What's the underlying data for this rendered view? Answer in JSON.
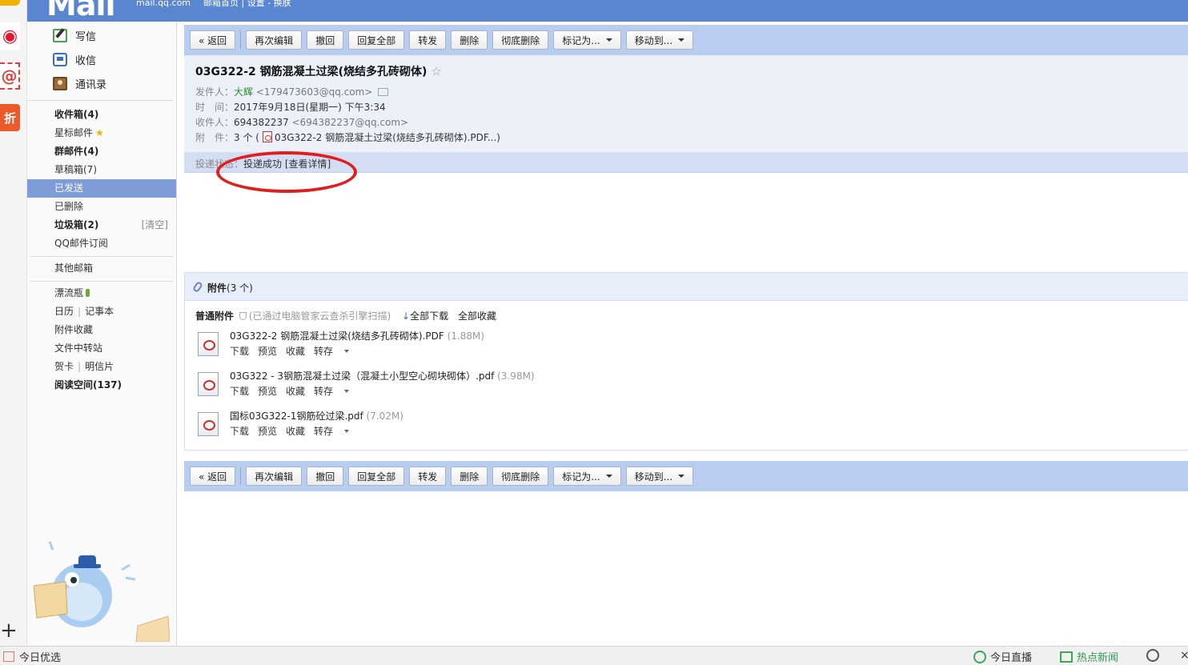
{
  "header": {
    "logo": "Mail",
    "domain": "mail.qq.com",
    "links": "邮箱首页 | 设置 - 换肤"
  },
  "apps": {
    "weibo_icon": "weibo-icon",
    "at_icon": "at-icon",
    "discount_label": "折",
    "add": "+"
  },
  "sidebar": {
    "write": "写信",
    "inbox_tool": "收信",
    "contacts": "通讯录",
    "folders": [
      {
        "label": "收件箱(4)",
        "bold": true
      },
      {
        "label": "星标邮件"
      },
      {
        "label": "群邮件(4)",
        "bold": true
      },
      {
        "label": "草稿箱(7)"
      },
      {
        "label": "已发送",
        "active": true
      },
      {
        "label": "已删除"
      },
      {
        "label": "垃圾箱(2)",
        "bold": true
      },
      {
        "label": "QQ邮件订阅"
      }
    ],
    "clear_trash": "[清空]",
    "other_mailboxes": "其他邮箱",
    "extras": {
      "drift_bottle": "漂流瓶",
      "calendar": "日历",
      "notebook": "记事本",
      "attachment_collection": "附件收藏",
      "file_transfer": "文件中转站",
      "greeting_card": "贺卡",
      "postcard": "明信片",
      "reading_space": "阅读空间(137)",
      "pipe": "|"
    }
  },
  "toolbar": {
    "back": "« 返回",
    "re_edit": "再次编辑",
    "recall": "撤回",
    "reply_all": "回复全部",
    "forward": "转发",
    "delete": "删除",
    "delete_permanently": "彻底删除",
    "mark_as": "标记为...",
    "move_to": "移动到..."
  },
  "mail": {
    "subject": "03G322-2 钢筋混凝土过梁(烧结多孔砖砌体)",
    "star": "☆",
    "from_label": "发件人：",
    "from_name": "大辉",
    "from_addr": "<179473603@qq.com>",
    "time_label": "时　间：",
    "time_value": "2017年9月18日(星期一) 下午3:34",
    "to_label": "收件人：",
    "to_name": "694382237",
    "to_addr": "<694382237@qq.com>",
    "attach_label": "附　件：",
    "attach_count": "3 个 (",
    "attach_first": "03G322-2 钢筋混凝土过梁(烧结多孔砖砌体).PDF...)",
    "status_label": "投递状态：",
    "status_value": "投递成功",
    "status_link": "[查看详情]"
  },
  "attachments": {
    "title": "附件",
    "count": "(3 个)",
    "type_label": "普通附件",
    "scan_note": "(已通过电脑管家云查杀引擎扫描)",
    "download_all": "全部下载",
    "collect_all": "全部收藏",
    "actions": {
      "download": "下载",
      "preview": "预览",
      "collect": "收藏",
      "save_to": "转存"
    },
    "files": [
      {
        "name": "03G322-2 钢筋混凝土过梁(烧结多孔砖砌体).PDF",
        "size": "(1.88M)"
      },
      {
        "name": "03G322 - 3钢筋混凝土过梁（混凝土小型空心砌块砌体）.pdf",
        "size": "(3.98M)"
      },
      {
        "name": "国标03G322-1钢筋砼过梁.pdf",
        "size": "(7.02M)"
      }
    ]
  },
  "taskbar": {
    "today_picks": "今日优选",
    "live_today": "今日直播",
    "hot_news": "热点新闻"
  },
  "colors": {
    "header_blue": "#5a86cf",
    "toolbar_blue": "#b9cdf0",
    "active_folder": "#7d9cd8",
    "annotation_red": "#e01e1e"
  }
}
